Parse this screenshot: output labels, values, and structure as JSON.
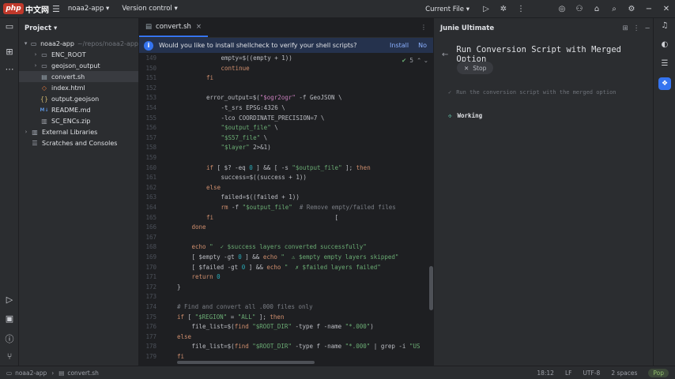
{
  "titlebar": {
    "logo": "php",
    "logo_cn": "中文网",
    "project_switch": "noaa2-app ▾",
    "version_control": "Version control ▾",
    "current_file": "Current File ▾"
  },
  "project_panel": {
    "title": "Project ▾",
    "items": [
      {
        "label": "noaa2-app",
        "sub": "~/repos/noaa2-app",
        "depth": 0,
        "twisty": "▾",
        "icon": "▭",
        "kind": "folder"
      },
      {
        "label": "ENC_ROOT",
        "sub": "",
        "depth": 1,
        "twisty": "›",
        "icon": "▭",
        "kind": "folder"
      },
      {
        "label": "geojson_output",
        "sub": "",
        "depth": 1,
        "twisty": "›",
        "icon": "▭",
        "kind": "folder"
      },
      {
        "label": "convert.sh",
        "sub": "",
        "depth": 1,
        "twisty": "",
        "icon": "▤",
        "kind": "sh",
        "selected": true
      },
      {
        "label": "index.html",
        "sub": "",
        "depth": 1,
        "twisty": "",
        "icon": "◇",
        "kind": "html"
      },
      {
        "label": "output.geojson",
        "sub": "",
        "depth": 1,
        "twisty": "",
        "icon": "{}",
        "kind": "json"
      },
      {
        "label": "README.md",
        "sub": "",
        "depth": 1,
        "twisty": "",
        "icon": "M↓",
        "kind": "md"
      },
      {
        "label": "SC_ENCs.zip",
        "sub": "",
        "depth": 1,
        "twisty": "",
        "icon": "▥",
        "kind": "zip"
      },
      {
        "label": "External Libraries",
        "sub": "",
        "depth": 0,
        "twisty": "›",
        "icon": "▥",
        "kind": "folder"
      },
      {
        "label": "Scratches and Consoles",
        "sub": "",
        "depth": 0,
        "twisty": "",
        "icon": "☰",
        "kind": "folder"
      }
    ]
  },
  "editor": {
    "tab_label": "convert.sh",
    "banner_text": "Would you like to install shellcheck to verify your shell scripts?",
    "banner_install": "Install",
    "banner_no": "No",
    "inspection_count": "5",
    "lines": [
      {
        "n": "149",
        "indent": 3,
        "segs": [
          [
            "empty=$((empty + 1))",
            ""
          ]
        ]
      },
      {
        "n": "150",
        "indent": 3,
        "segs": [
          [
            "continue",
            "kw"
          ]
        ]
      },
      {
        "n": "151",
        "indent": 2,
        "segs": [
          [
            "fi",
            "kw"
          ]
        ]
      },
      {
        "n": "152",
        "indent": 0,
        "segs": []
      },
      {
        "n": "153",
        "indent": 2,
        "segs": [
          [
            "error_output=$(",
            ""
          ],
          [
            "\"$ogr2ogr\"",
            "var"
          ],
          [
            " -f GeoJSON \\",
            ""
          ]
        ]
      },
      {
        "n": "154",
        "indent": 3,
        "segs": [
          [
            "-t_srs EPSG:4326 \\",
            ""
          ]
        ]
      },
      {
        "n": "155",
        "indent": 3,
        "segs": [
          [
            "-lco COORDINATE_PRECISION=7 \\",
            ""
          ]
        ]
      },
      {
        "n": "156",
        "indent": 3,
        "segs": [
          [
            "\"$output_file\"",
            "str"
          ],
          [
            " \\",
            ""
          ]
        ]
      },
      {
        "n": "157",
        "indent": 3,
        "segs": [
          [
            "\"$S57_file\"",
            "str"
          ],
          [
            " \\",
            ""
          ]
        ]
      },
      {
        "n": "158",
        "indent": 3,
        "segs": [
          [
            "\"$layer\"",
            "str"
          ],
          [
            " 2>&1)",
            ""
          ]
        ]
      },
      {
        "n": "159",
        "indent": 0,
        "segs": []
      },
      {
        "n": "160",
        "indent": 2,
        "segs": [
          [
            "if",
            "kw"
          ],
          [
            " [ $? -eq ",
            ""
          ],
          [
            "0",
            "num"
          ],
          [
            " ] && [ -s ",
            ""
          ],
          [
            "\"$output_file\"",
            "str"
          ],
          [
            " ]; ",
            ""
          ],
          [
            "then",
            "kw"
          ]
        ]
      },
      {
        "n": "161",
        "indent": 3,
        "segs": [
          [
            "success=$((success + 1))",
            ""
          ]
        ]
      },
      {
        "n": "162",
        "indent": 2,
        "segs": [
          [
            "else",
            "kw"
          ]
        ]
      },
      {
        "n": "163",
        "indent": 3,
        "segs": [
          [
            "failed=$((failed + 1))",
            ""
          ]
        ]
      },
      {
        "n": "164",
        "indent": 3,
        "segs": [
          [
            "rm",
            "kw"
          ],
          [
            " -f ",
            ""
          ],
          [
            "\"$output_file\"",
            "str"
          ],
          [
            "  ",
            ""
          ],
          [
            "# Remove empty/failed files",
            "cmt"
          ]
        ]
      },
      {
        "n": "165",
        "indent": 2,
        "segs": [
          [
            "fi",
            "kw"
          ],
          [
            "                                  [",
            ""
          ]
        ]
      },
      {
        "n": "166",
        "indent": 1,
        "segs": [
          [
            "done",
            "kw"
          ]
        ]
      },
      {
        "n": "167",
        "indent": 0,
        "segs": []
      },
      {
        "n": "168",
        "indent": 1,
        "segs": [
          [
            "echo",
            "kw"
          ],
          [
            " \"  ✓ $success layers converted successfully\"",
            "str"
          ]
        ]
      },
      {
        "n": "169",
        "indent": 1,
        "segs": [
          [
            "[ $empty -gt ",
            ""
          ],
          [
            "0",
            "num"
          ],
          [
            " ] && ",
            ""
          ],
          [
            "echo",
            "kw"
          ],
          [
            " \"  ⚠ $empty empty layers skipped\"",
            "str"
          ]
        ]
      },
      {
        "n": "170",
        "indent": 1,
        "segs": [
          [
            "[ $failed -gt ",
            ""
          ],
          [
            "0",
            "num"
          ],
          [
            " ] && ",
            ""
          ],
          [
            "echo",
            "kw"
          ],
          [
            " \"  ✗ $failed layers failed\"",
            "str"
          ]
        ]
      },
      {
        "n": "171",
        "indent": 1,
        "segs": [
          [
            "return",
            "kw"
          ],
          [
            " ",
            ""
          ],
          [
            "0",
            "num"
          ]
        ]
      },
      {
        "n": "172",
        "indent": 0,
        "segs": [
          [
            "}",
            ""
          ]
        ]
      },
      {
        "n": "173",
        "indent": 0,
        "segs": []
      },
      {
        "n": "174",
        "indent": 0,
        "segs": [
          [
            "# Find and convert all .000 files only",
            "cmt"
          ]
        ]
      },
      {
        "n": "175",
        "indent": 0,
        "segs": [
          [
            "if",
            "kw"
          ],
          [
            " [ ",
            ""
          ],
          [
            "\"$REGION\"",
            "str"
          ],
          [
            " = ",
            ""
          ],
          [
            "\"ALL\"",
            "str"
          ],
          [
            " ]; ",
            ""
          ],
          [
            "then",
            "kw"
          ]
        ]
      },
      {
        "n": "176",
        "indent": 1,
        "segs": [
          [
            "file_list=$(",
            ""
          ],
          [
            "find",
            "kw"
          ],
          [
            " ",
            ""
          ],
          [
            "\"$ROOT_DIR\"",
            "str"
          ],
          [
            " -type f -name ",
            ""
          ],
          [
            "\"*.000\"",
            "str"
          ],
          [
            ")",
            ""
          ]
        ]
      },
      {
        "n": "177",
        "indent": 0,
        "segs": [
          [
            "else",
            "kw"
          ]
        ]
      },
      {
        "n": "178",
        "indent": 1,
        "segs": [
          [
            "file_list=$(",
            ""
          ],
          [
            "find",
            "kw"
          ],
          [
            " ",
            ""
          ],
          [
            "\"$ROOT_DIR\"",
            "str"
          ],
          [
            " -type f -name ",
            ""
          ],
          [
            "\"*.000\"",
            "str"
          ],
          [
            " | grep -i ",
            ""
          ],
          [
            "\"US",
            "str"
          ]
        ]
      },
      {
        "n": "179",
        "indent": 0,
        "segs": [
          [
            "fi",
            "kw"
          ]
        ]
      }
    ]
  },
  "junie": {
    "panel_title": "Junie Ultimate",
    "task_title": "Run Conversion Script with Merged Option",
    "stop_label": "Stop",
    "step_text": "Run the conversion script with the merged option",
    "working_label": "Working"
  },
  "statusbar": {
    "project": "noaa2-app",
    "file": "convert.sh",
    "position": "18:12",
    "line_sep": "LF",
    "encoding": "UTF-8",
    "indent": "2 spaces",
    "lang": "Pop"
  },
  "colors": {
    "accent": "#3574f0",
    "bg": "#1e1f22",
    "panel": "#2b2d30"
  }
}
